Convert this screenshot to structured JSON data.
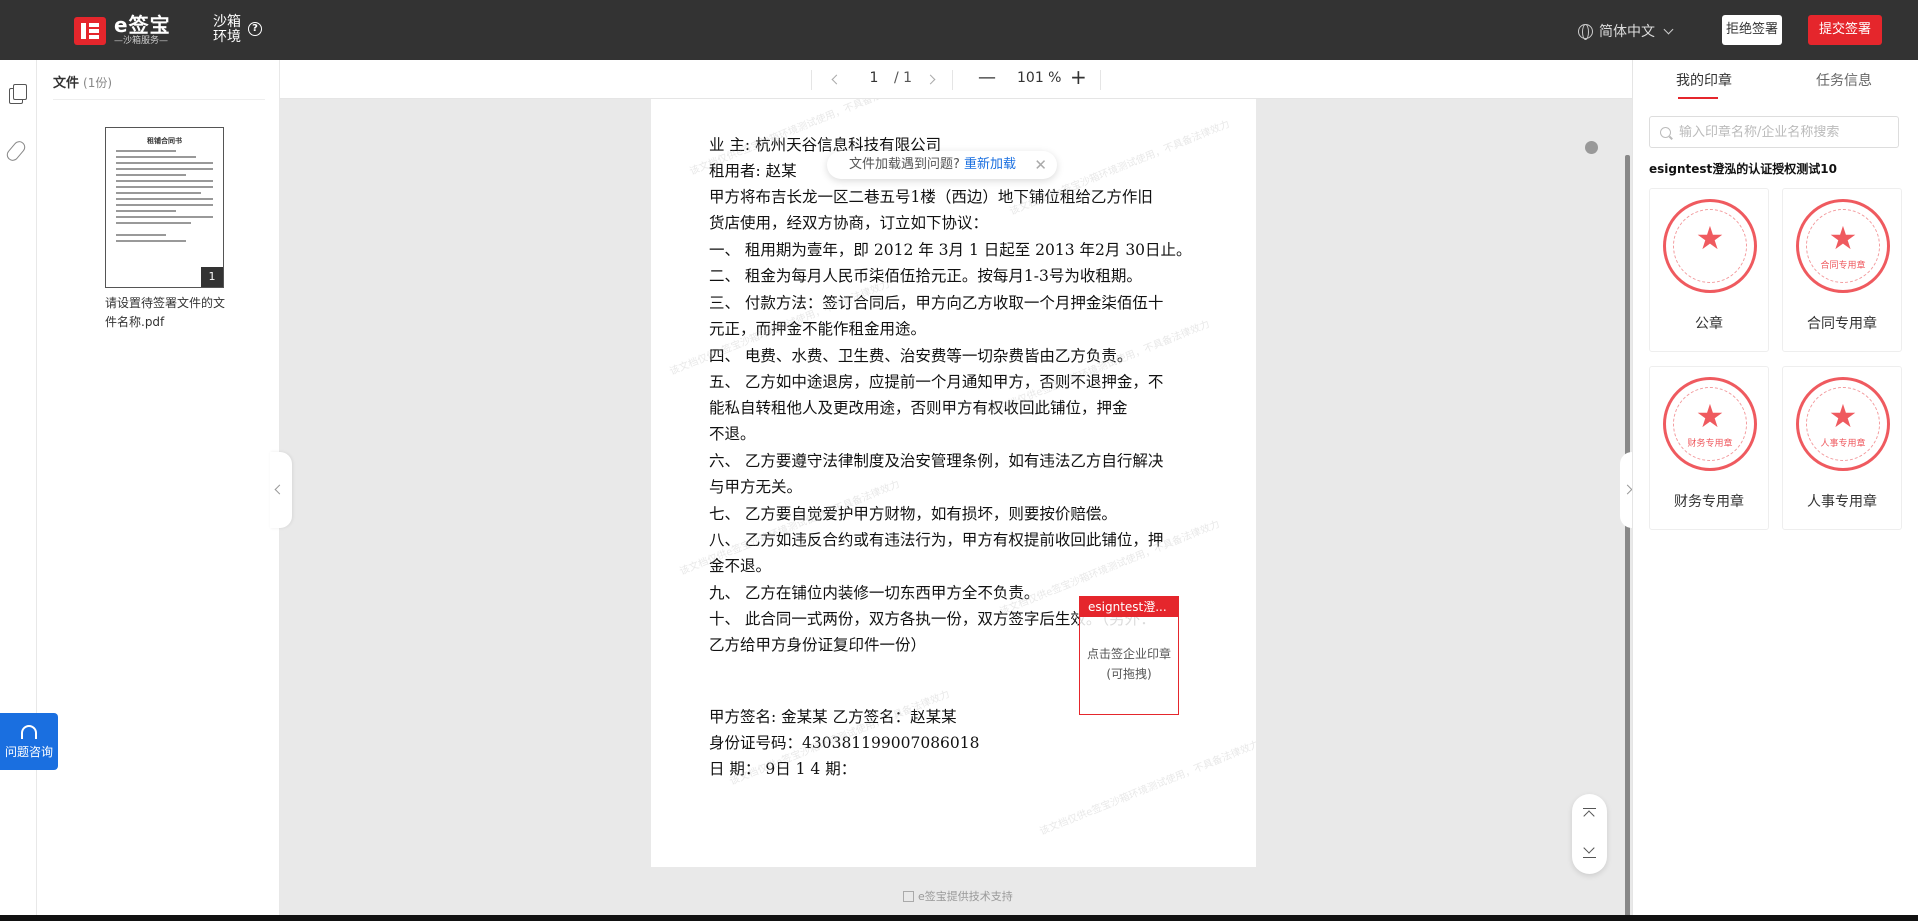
{
  "topbar": {
    "logo_title": "e签宝",
    "logo_sub": "—沙箱服务—",
    "sandbox": "沙箱环境",
    "language": "简体中文",
    "reject": "拒绝签署",
    "submit": "提交签署"
  },
  "files": {
    "title": "文件",
    "count": "(1份)",
    "thumb_title": "租铺合同书",
    "thumb_page": "1",
    "name": "请设置待签署文件的文件名称.pdf"
  },
  "toolbar": {
    "page": "1",
    "total": "/ 1",
    "minus": "—",
    "zoom": "101 %",
    "plus": "+"
  },
  "document": {
    "lines": [
      "业  主:     杭州天谷信息科技有限公司",
      "租用者:     赵某",
      "    甲方将布吉长龙一区二巷五号1楼（西边）地下铺位租给乙方作旧",
      "货店使用，经双方协商，订立如下协议：",
      "一、   租用期为壹年，即 2012 年 3月 1 日起至 2013 年2月 30日止。",
      "二、   租金为每月人民币柒佰伍拾元正。按每月1-3号为收租期。",
      "三、   付款方法：签订合同后，甲方向乙方收取一个月押金柒佰伍十",
      "        元正，而押金不能作租金用途。",
      "四、   电费、水费、卫生费、治安费等一切杂费皆由乙方负责。",
      "五、   乙方如中途退房，应提前一个月通知甲方，否则不退押金，不",
      "        能私自转租他人及更改用途，否则甲方有权收回此铺位，押金",
      "        不退。",
      "六、   乙方要遵守法律制度及治安管理条例，如有违法乙方自行解决",
      "        与甲方无关。",
      "七、   乙方要自觉爱护甲方财物，如有损坏，则要按价赔偿。",
      "八、   乙方如违反合约或有违法行为，甲方有权提前收回此铺位，押",
      "        金不退。",
      "九、   乙方在铺位内装修一切东西甲方全不负责。",
      "十、   此合同一式两份，双方各执一份，双方签字后生效。（另外：",
      "        乙方给甲方身份证复印件一份）",
      "        甲方签名:    金某某     乙方签名：赵某某",
      "                          身份证号码：430381199007086018",
      "          日    期：          9日    1 4 期："
    ],
    "watermark": "该文档仅供e签宝沙箱环境测试使用，不具备法律效力"
  },
  "reload_tip": {
    "text": "文件加载遇到问题?",
    "link": "重新加载",
    "close": "✕"
  },
  "seal_placeholder": {
    "head": "esigntest澄...",
    "line1": "点击签企业印章",
    "line2": "(可拖拽)"
  },
  "footer_brand": "e签宝提供技术支持",
  "help_float": "问题咨询",
  "right_panel": {
    "tab_seal": "我的印章",
    "tab_task": "任务信息",
    "search_placeholder": "输入印章名称/企业名称搜索",
    "org": "esigntest澄泓的认证授权测试10",
    "seals": [
      {
        "label": "公章",
        "sub": ""
      },
      {
        "label": "合同专用章",
        "sub": "合同专用章"
      },
      {
        "label": "财务专用章",
        "sub": "财务专用章"
      },
      {
        "label": "人事专用章",
        "sub": "人事专用章"
      }
    ]
  },
  "colors": {
    "brand_red": "#e5262c",
    "link_blue": "#1a6fe0",
    "topbar": "#333333"
  }
}
